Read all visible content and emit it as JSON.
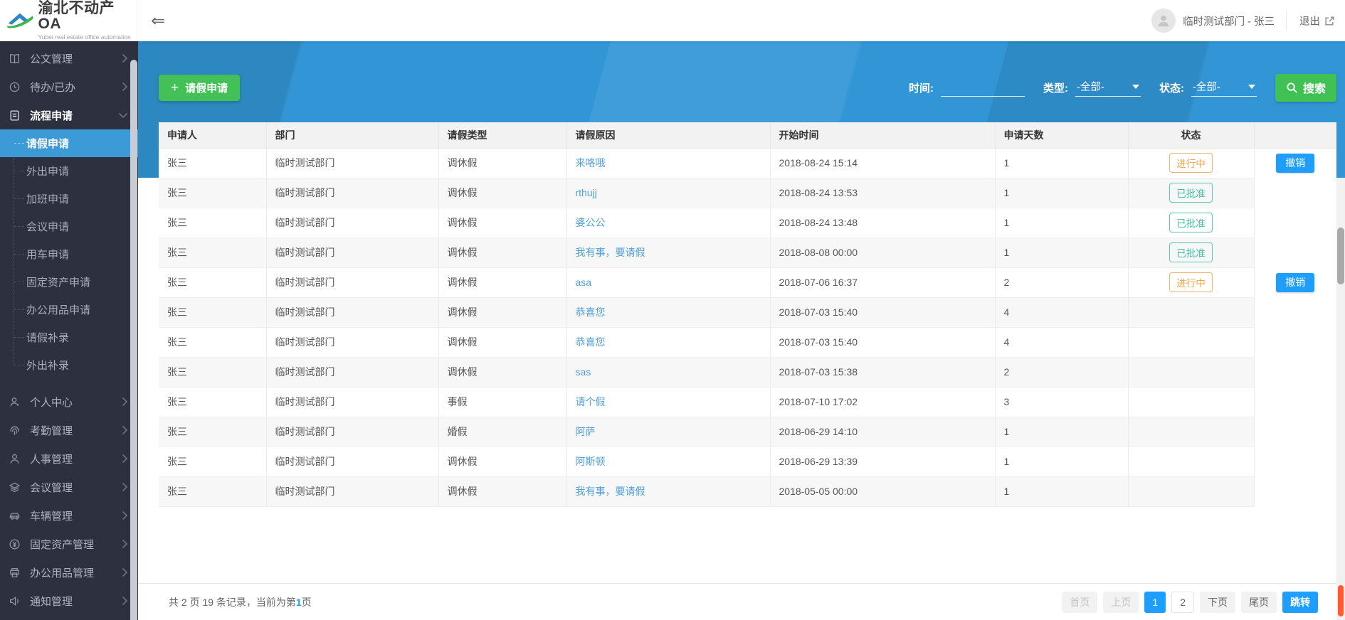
{
  "app": {
    "title": "渝北不动产OA",
    "subtitle": "Yubei real estate office automation"
  },
  "topbar": {
    "collapse_icon": "⇐",
    "user_name": "临时测试部门 - 张三",
    "logout_label": "退出"
  },
  "sidebar": {
    "items": [
      {
        "label": "公文管理",
        "icon": "book-icon"
      },
      {
        "label": "待办/已办",
        "icon": "clock-icon"
      },
      {
        "label": "流程申请",
        "icon": "document-icon",
        "expanded": true,
        "children": [
          {
            "label": "请假申请",
            "active": true
          },
          {
            "label": "外出申请"
          },
          {
            "label": "加班申请"
          },
          {
            "label": "会议申请"
          },
          {
            "label": "用车申请"
          },
          {
            "label": "固定资产申请"
          },
          {
            "label": "办公用品申请"
          },
          {
            "label": "请假补录"
          },
          {
            "label": "外出补录"
          }
        ]
      },
      {
        "label": "个人中心",
        "icon": "person-star-icon"
      },
      {
        "label": "考勤管理",
        "icon": "fingerprint-icon"
      },
      {
        "label": "人事管理",
        "icon": "person-icon"
      },
      {
        "label": "会议管理",
        "icon": "layers-icon"
      },
      {
        "label": "车辆管理",
        "icon": "car-icon"
      },
      {
        "label": "固定资产管理",
        "icon": "yen-icon"
      },
      {
        "label": "办公用品管理",
        "icon": "printer-icon"
      },
      {
        "label": "通知管理",
        "icon": "speaker-icon"
      }
    ]
  },
  "toolbar": {
    "plus": "+",
    "new_request_label": "请假申请"
  },
  "filters": {
    "time_label": "时间:",
    "time_value": "",
    "type_label": "类型:",
    "type_value": "-全部-",
    "status_label": "状态:",
    "status_value": "-全部-",
    "search_label": "搜索"
  },
  "table": {
    "columns": [
      "申请人",
      "部门",
      "请假类型",
      "请假原因",
      "开始时间",
      "申请天数",
      "状态",
      ""
    ],
    "rows": [
      {
        "applicant": "张三",
        "department": "临时测试部门",
        "leave_type": "调休假",
        "reason": "来咯哦",
        "start_time": "2018-08-24 15:14",
        "days": "1",
        "status": "进行中",
        "action": "撤销"
      },
      {
        "applicant": "张三",
        "department": "临时测试部门",
        "leave_type": "调休假",
        "reason": "rthujj",
        "start_time": "2018-08-24 13:53",
        "days": "1",
        "status": "已批准",
        "action": ""
      },
      {
        "applicant": "张三",
        "department": "临时测试部门",
        "leave_type": "调休假",
        "reason": "婆公公",
        "start_time": "2018-08-24 13:48",
        "days": "1",
        "status": "已批准",
        "action": ""
      },
      {
        "applicant": "张三",
        "department": "临时测试部门",
        "leave_type": "调休假",
        "reason": "我有事，要请假",
        "start_time": "2018-08-08 00:00",
        "days": "1",
        "status": "已批准",
        "action": ""
      },
      {
        "applicant": "张三",
        "department": "临时测试部门",
        "leave_type": "调休假",
        "reason": "asa",
        "start_time": "2018-07-06 16:37",
        "days": "2",
        "status": "进行中",
        "action": "撤销"
      },
      {
        "applicant": "张三",
        "department": "临时测试部门",
        "leave_type": "调休假",
        "reason": "恭喜您",
        "start_time": "2018-07-03 15:40",
        "days": "4",
        "status": "",
        "action": ""
      },
      {
        "applicant": "张三",
        "department": "临时测试部门",
        "leave_type": "调休假",
        "reason": "恭喜您",
        "start_time": "2018-07-03 15:40",
        "days": "4",
        "status": "",
        "action": ""
      },
      {
        "applicant": "张三",
        "department": "临时测试部门",
        "leave_type": "调休假",
        "reason": "sas",
        "start_time": "2018-07-03 15:38",
        "days": "2",
        "status": "",
        "action": ""
      },
      {
        "applicant": "张三",
        "department": "临时测试部门",
        "leave_type": "事假",
        "reason": "请个假",
        "start_time": "2018-07-10 17:02",
        "days": "3",
        "status": "",
        "action": ""
      },
      {
        "applicant": "张三",
        "department": "临时测试部门",
        "leave_type": "婚假",
        "reason": "阿萨",
        "start_time": "2018-06-29 14:10",
        "days": "1",
        "status": "",
        "action": ""
      },
      {
        "applicant": "张三",
        "department": "临时测试部门",
        "leave_type": "调休假",
        "reason": "阿斯顿",
        "start_time": "2018-06-29 13:39",
        "days": "1",
        "status": "",
        "action": ""
      },
      {
        "applicant": "张三",
        "department": "临时测试部门",
        "leave_type": "调休假",
        "reason": "我有事，要请假",
        "start_time": "2018-05-05 00:00",
        "days": "1",
        "status": "",
        "action": ""
      }
    ]
  },
  "footer": {
    "summary_prefix": "共 2 页 19 条记录，当前为第",
    "current_page": "1",
    "summary_suffix": "页"
  },
  "pagination": {
    "first": "首页",
    "prev": "上页",
    "p1": "1",
    "p2": "2",
    "next": "下页",
    "last": "尾页",
    "jump": "跳转"
  },
  "colors": {
    "accent_blue": "#1E9FFF",
    "button_green": "#43c156",
    "banner_blue": "#3296d6",
    "link_blue": "#519fd7",
    "badge_orange": "#f2a54a",
    "badge_teal": "#42c1a4",
    "sidebar_bg": "#2d303e",
    "active_item_blue": "#3c9ad6"
  }
}
